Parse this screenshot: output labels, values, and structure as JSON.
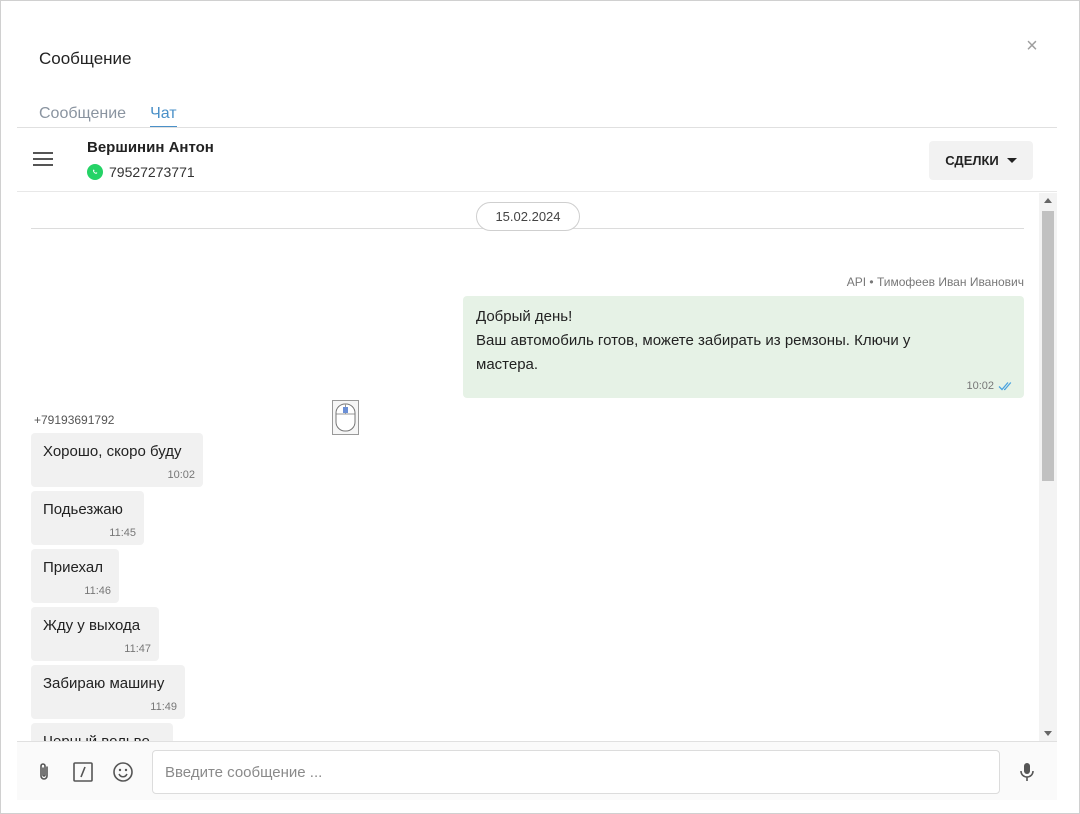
{
  "dialog": {
    "title": "Сообщение",
    "close_glyph": "×"
  },
  "tabs": [
    {
      "label": "Сообщение",
      "active": false
    },
    {
      "label": "Чат",
      "active": true
    }
  ],
  "chat_header": {
    "contact_name": "Вершинин Антон",
    "contact_phone": "79527273771",
    "channel_icon": "whatsapp-icon",
    "deals_label": "СДЕЛКИ"
  },
  "messages": {
    "date": "15.02.2024",
    "outgoing": {
      "sender": "API • Тимофеев Иван Иванович",
      "line1": "Добрый день!",
      "line2": "Ваш автомобиль готов, можете забирать из ремзоны. Ключи у",
      "line3": "мастера.",
      "time": "10:02",
      "status_icon": "double-check-icon"
    },
    "incoming_sender": "+79193691792",
    "incoming": [
      {
        "text": "Хорошо, скоро буду",
        "time": "10:02"
      },
      {
        "text": "Подьезжаю",
        "time": "11:45"
      },
      {
        "text": "Приехал",
        "time": "11:46"
      },
      {
        "text": "Жду у выхода",
        "time": "11:47"
      },
      {
        "text": "Забираю машину",
        "time": "11:49"
      },
      {
        "text": "Черный вольво",
        "time": ""
      }
    ]
  },
  "composer": {
    "placeholder": "Введите сообщение ...",
    "value": ""
  },
  "colors": {
    "accent": "#4a90c8",
    "outgoing_bubble": "#e6f2e6",
    "incoming_bubble": "#f1f1f1",
    "whatsapp": "#25d366",
    "read_check": "#4aa3df"
  }
}
